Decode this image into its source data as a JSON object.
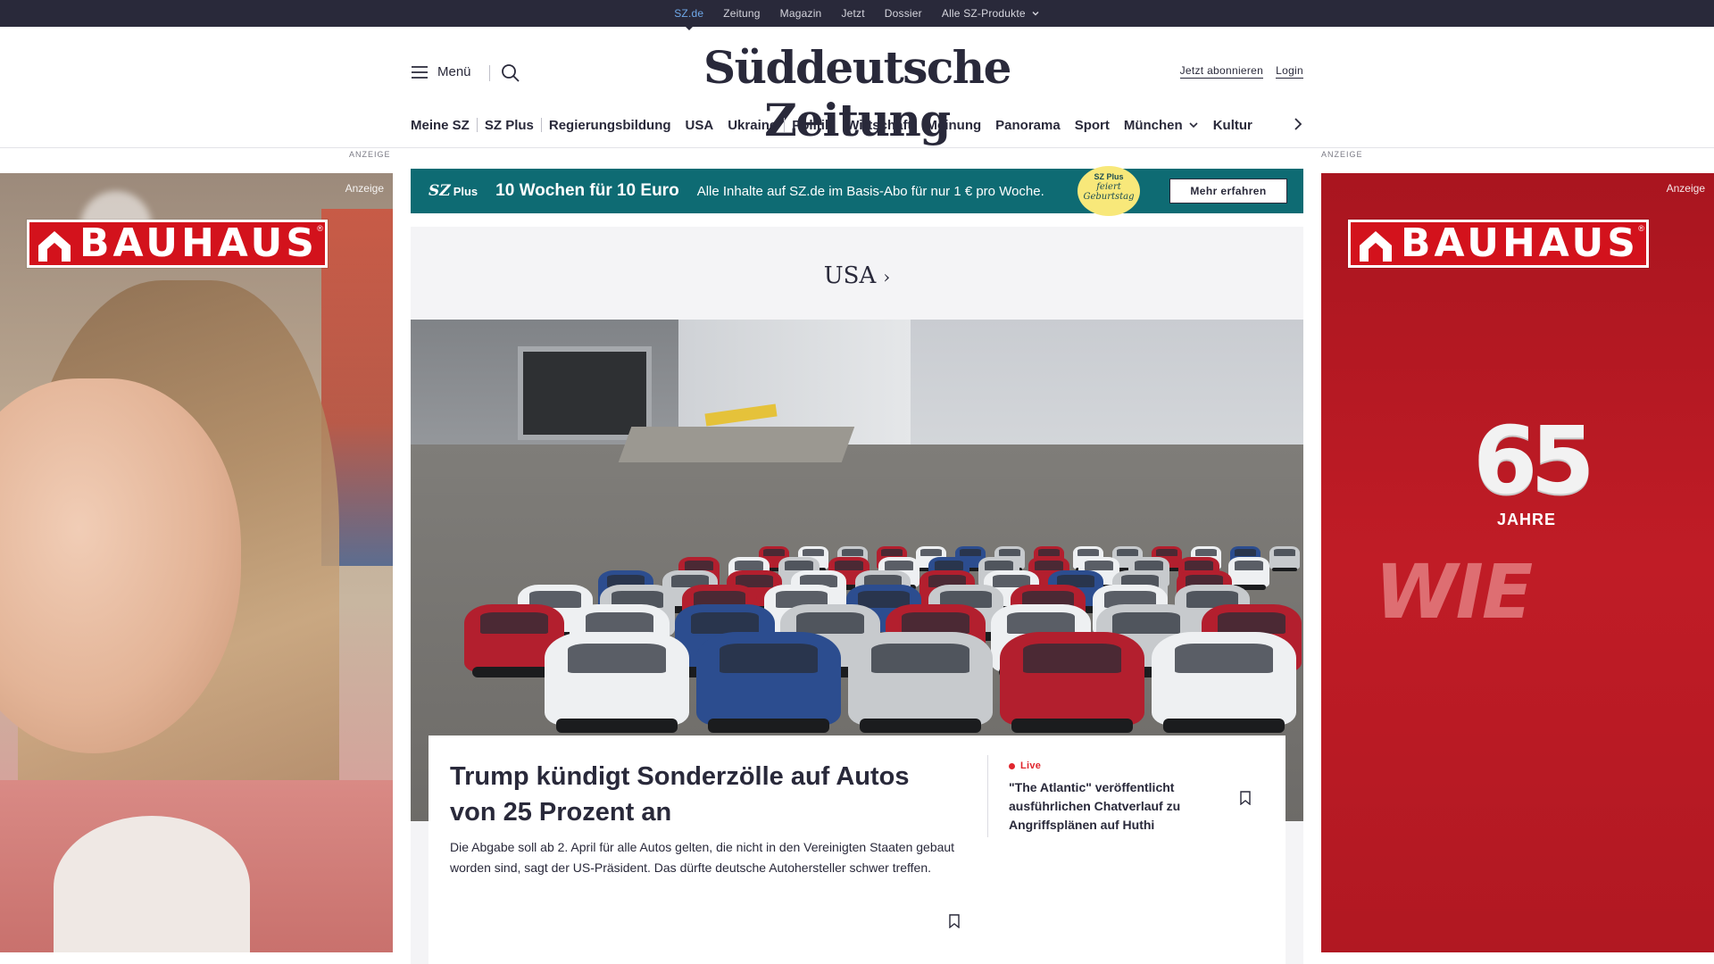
{
  "topbar": {
    "items": [
      "SZ.de",
      "Zeitung",
      "Magazin",
      "Jetzt",
      "Dossier",
      "Alle SZ-Produkte"
    ],
    "active_index": 0
  },
  "masthead": {
    "menu_label": "Menü",
    "logo_text": "Süddeutsche Zeitung",
    "subscribe_label": "Jetzt abonnieren",
    "login_label": "Login"
  },
  "nav": {
    "items": [
      "Meine SZ",
      "SZ Plus",
      "Regierungsbildung",
      "USA",
      "Ukraine",
      "Politik",
      "Wirtschaft",
      "Meinung",
      "Panorama",
      "Sport",
      "München",
      "Kultur"
    ]
  },
  "ads": {
    "section_label": "ANZEIGE",
    "tag": "Anzeige",
    "brand": "BAUHAUS",
    "years_number": "65",
    "years_label": "JAHRE",
    "slogan": "WIE"
  },
  "plus_banner": {
    "logo": "SZ",
    "logo_suffix": "Plus",
    "offer": "10 Wochen für 10 Euro",
    "text": "Alle Inhalte auf SZ.de im Basis-Abo für nur 1 € pro Woche.",
    "badge_top": "SZ Plus",
    "badge_text": "feiert Geburtstag",
    "cta": "Mehr erfahren",
    "color": "#0e6b73"
  },
  "section": {
    "title": "USA"
  },
  "article": {
    "headline": "Trump kündigt Sonderzölle auf Autos von 25 Prozent an",
    "teaser": "Die Abgabe soll ab 2. April für alle Autos gelten, die nicht in den Vereinigten Staaten gebaut worden sind, sagt der US-Präsident. Das dürfte deutsche Autohersteller schwer treffen."
  },
  "side_article": {
    "badge": "Live",
    "title": "\"The Atlantic\" veröffentlicht ausführlichen Chatverlauf zu Angriffsplänen auf Huthi"
  },
  "icons": {
    "menu": "hamburger-icon",
    "search": "search-icon",
    "bookmark": "bookmark-icon",
    "chevron": "chevron-right-icon"
  }
}
